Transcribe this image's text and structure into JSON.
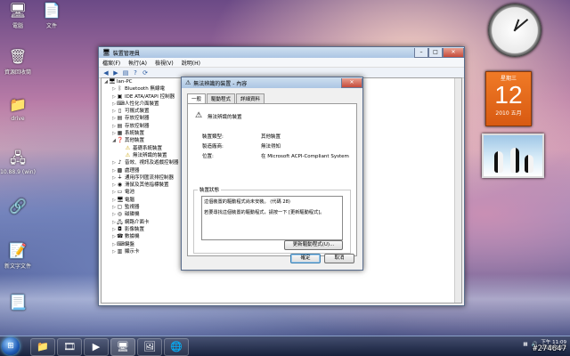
{
  "desktop": {
    "icons": [
      {
        "label": "電腦",
        "icon": "computer-icon"
      },
      {
        "label": "文件",
        "icon": "document-icon"
      },
      {
        "label": "資源回收筒",
        "icon": "recycle-bin-icon"
      },
      {
        "label": "drive",
        "icon": "folder-icon"
      },
      {
        "label": "10.88.9 (win)",
        "icon": "network-icon"
      },
      {
        "label": "",
        "icon": "shortcut-icon"
      },
      {
        "label": "新文字文件",
        "icon": "text-file-icon"
      },
      {
        "label": "",
        "icon": "file-icon"
      }
    ]
  },
  "gadgets": {
    "calendar": {
      "day_of_week": "星期三",
      "day": "12",
      "year_month": "2010 五月"
    }
  },
  "device_manager": {
    "title": "裝置管理員",
    "menu": [
      "檔案(F)",
      "執行(A)",
      "檢視(V)",
      "說明(H)"
    ],
    "tree": [
      {
        "label": "lan-PC",
        "level": 0,
        "expander": "◢",
        "icon": "computer-icon"
      },
      {
        "label": "Bluetooth 無線電",
        "level": 1,
        "expander": "▷",
        "icon": "bluetooth-icon"
      },
      {
        "label": "IDE ATA/ATAPI 控制器",
        "level": 1,
        "expander": "▷",
        "icon": "chip-icon"
      },
      {
        "label": "人性化介面裝置",
        "level": 1,
        "expander": "▷",
        "icon": "hid-icon"
      },
      {
        "label": "可攜式裝置",
        "level": 1,
        "expander": "▷",
        "icon": "portable-icon"
      },
      {
        "label": "存放控制器",
        "level": 1,
        "expander": "▷",
        "icon": "storage-icon"
      },
      {
        "label": "存放控制器",
        "level": 1,
        "expander": "▷",
        "icon": "storage-icon"
      },
      {
        "label": "系統裝置",
        "level": 1,
        "expander": "▷",
        "icon": "system-icon"
      },
      {
        "label": "其他裝置",
        "level": 1,
        "expander": "◢",
        "icon": "other-icon"
      },
      {
        "label": "基礎系統裝置",
        "level": 2,
        "expander": "",
        "icon": "warning-icon"
      },
      {
        "label": "無法辨識的裝置",
        "level": 2,
        "expander": "",
        "icon": "warning-icon"
      },
      {
        "label": "音效、視訊及遊戲控制器",
        "level": 1,
        "expander": "▷",
        "icon": "sound-icon"
      },
      {
        "label": "處理器",
        "level": 1,
        "expander": "▷",
        "icon": "cpu-icon"
      },
      {
        "label": "通用序列匯流排控制器",
        "level": 1,
        "expander": "▷",
        "icon": "usb-icon"
      },
      {
        "label": "滑鼠及其他指標裝置",
        "level": 1,
        "expander": "▷",
        "icon": "mouse-icon"
      },
      {
        "label": "電池",
        "level": 1,
        "expander": "▷",
        "icon": "battery-icon"
      },
      {
        "label": "電腦",
        "level": 1,
        "expander": "▷",
        "icon": "computer-icon"
      },
      {
        "label": "監視器",
        "level": 1,
        "expander": "▷",
        "icon": "monitor-icon"
      },
      {
        "label": "磁碟機",
        "level": 1,
        "expander": "▷",
        "icon": "disk-icon"
      },
      {
        "label": "網路介面卡",
        "level": 1,
        "expander": "▷",
        "icon": "network-icon"
      },
      {
        "label": "影像裝置",
        "level": 1,
        "expander": "▷",
        "icon": "camera-icon"
      },
      {
        "label": "數據機",
        "level": 1,
        "expander": "▷",
        "icon": "modem-icon"
      },
      {
        "label": "鍵盤",
        "level": 1,
        "expander": "▷",
        "icon": "keyboard-icon"
      },
      {
        "label": "顯示卡",
        "level": 1,
        "expander": "▷",
        "icon": "display-icon"
      }
    ]
  },
  "properties": {
    "title": "無法辨識的裝置 - 內容",
    "tabs": [
      "一般",
      "驅動程式",
      "詳細資料"
    ],
    "device_name": "無法辨識的裝置",
    "rows": [
      {
        "label": "裝置類型:",
        "value": "其他裝置"
      },
      {
        "label": "製造廠商:",
        "value": "無法得知"
      },
      {
        "label": "位置:",
        "value": "在 Microsoft ACPI-Compliant System"
      }
    ],
    "status_legend": "裝置狀態",
    "status_line1": "這個裝置的驅動程式尚未安裝。 (代碼 28)",
    "status_line2": "若要尋找這個裝置的驅動程式，請按一下 [更新驅動程式]。",
    "update_button": "更新驅動程式(U)...",
    "ok_button": "確定",
    "cancel_button": "取消"
  },
  "taskbar": {
    "time": "下午 11:09",
    "date": "2010/5/12",
    "items": [
      "windows-explorer-icon",
      "media-player-icon",
      "device-manager-icon",
      "photo-icon",
      "internet-icon"
    ]
  },
  "watermark": "#274647"
}
